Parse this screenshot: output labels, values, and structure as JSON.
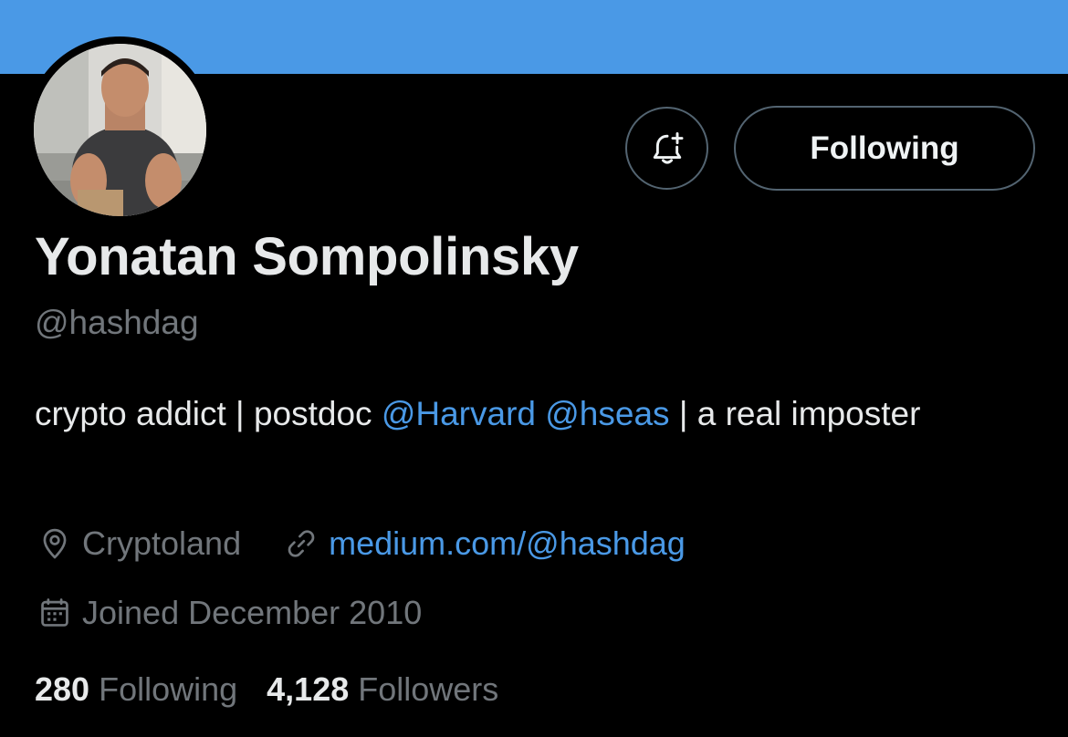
{
  "profile": {
    "display_name": "Yonatan Sompolinsky",
    "handle": "@hashdag",
    "bio": {
      "text_1": "crypto addict | postdoc ",
      "mention_1": "@Harvard",
      "mention_2": "@hseas",
      "text_2": " | a real imposter"
    },
    "location": "Cryptoland",
    "website": "medium.com/@hashdag",
    "joined": "Joined December 2010"
  },
  "actions": {
    "notify_icon": "bell-plus-icon",
    "following_label": "Following"
  },
  "stats": {
    "following_count": "280",
    "following_label": "Following",
    "followers_count": "4,128",
    "followers_label": "Followers"
  },
  "icons": {
    "location": "map-pin-icon",
    "link": "link-icon",
    "calendar": "calendar-icon"
  },
  "colors": {
    "banner": "#4a99e6",
    "background": "#000000",
    "link": "#4a99e6",
    "secondary_text": "#71767b",
    "border": "#536471"
  }
}
